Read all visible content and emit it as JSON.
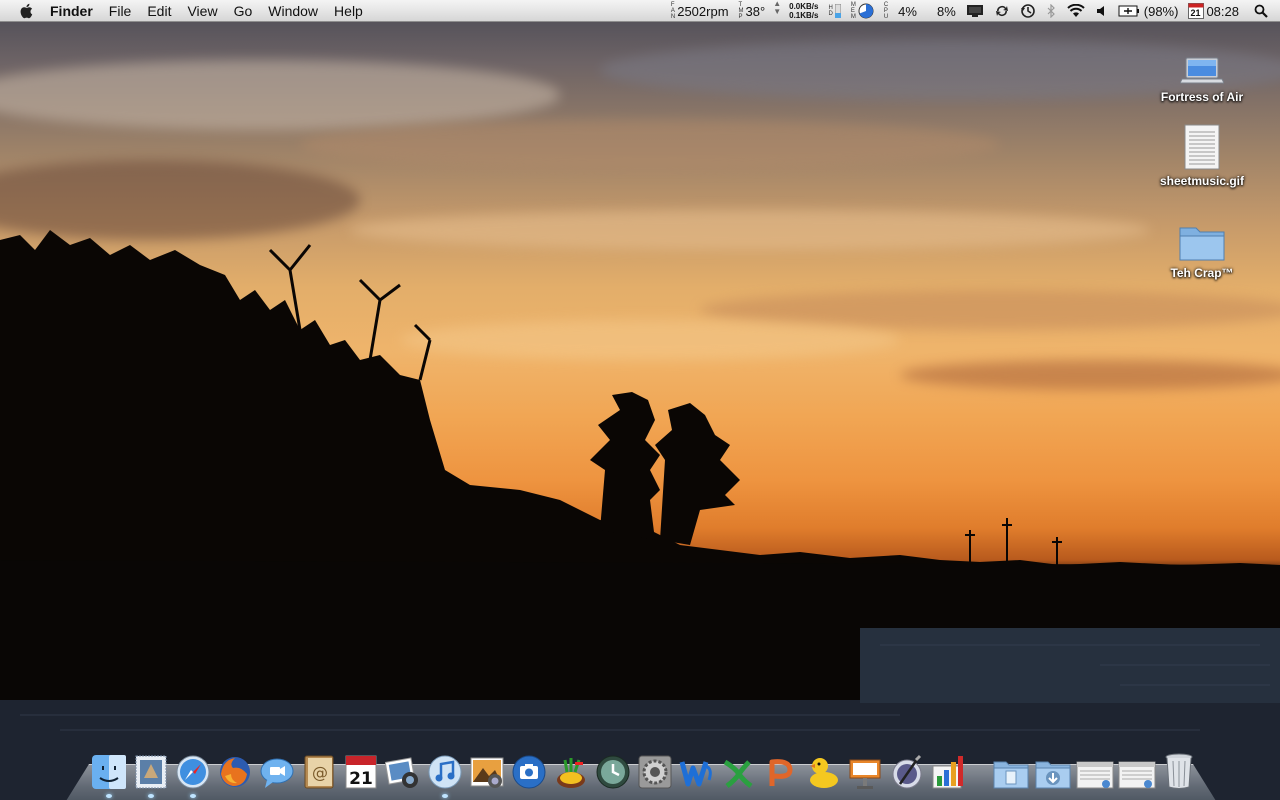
{
  "menubar": {
    "app_name": "Finder",
    "menus": [
      "File",
      "Edit",
      "View",
      "Go",
      "Window",
      "Help"
    ],
    "status": {
      "fan_speed": "2502rpm",
      "temperature": "38°",
      "net_up": "0.0KB/s",
      "net_down": "0.1KB/s",
      "cpu1": "4%",
      "cpu2": "8%",
      "battery": "(98%)",
      "calendar_day": "21",
      "clock": "08:28"
    }
  },
  "desktop_icons": [
    {
      "label": "Fortress of Air",
      "icon": "laptop-icon"
    },
    {
      "label": "sheetmusic.gif",
      "icon": "document-icon"
    },
    {
      "label": "Teh Crap™",
      "icon": "folder-icon"
    }
  ],
  "dock": {
    "calendar_date": "21",
    "apps": [
      "finder-icon",
      "mail-icon",
      "safari-icon",
      "firefox-icon",
      "ichat-icon",
      "address-book-icon",
      "ical-icon",
      "iphoto-icon",
      "itunes-icon",
      "preview-icon",
      "image-capture-icon",
      "adium-icon",
      "time-machine-icon",
      "system-preferences-icon",
      "word-icon",
      "excel-icon",
      "powerpoint-icon",
      "cyberduck-icon",
      "keynote-icon",
      "script-editor-icon",
      "numbers-icon"
    ],
    "stacks": [
      "documents-folder-icon",
      "downloads-folder-icon",
      "window-icon",
      "window-icon",
      "trash-icon"
    ]
  },
  "colors": {
    "menubar_bg": "#e6e6e6",
    "sky_top": "#4a4a55",
    "sunset": "#ee9440",
    "water": "#1d232e"
  }
}
